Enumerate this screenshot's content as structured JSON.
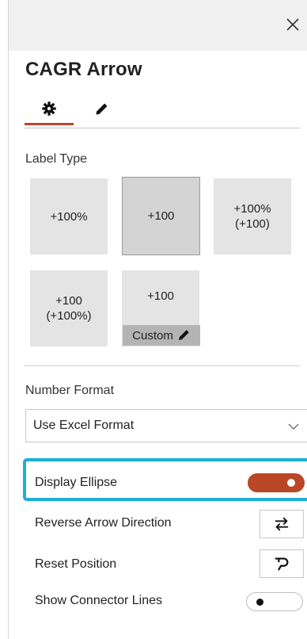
{
  "panel": {
    "title": "CAGR Arrow",
    "close_icon": "close-icon",
    "tabs": [
      {
        "name": "settings",
        "icon": "gear-icon",
        "active": true
      },
      {
        "name": "style",
        "icon": "pencil-icon",
        "active": false
      }
    ]
  },
  "label_type": {
    "heading": "Label Type",
    "options": [
      {
        "text": "+100%",
        "selected": false
      },
      {
        "text": "+100",
        "selected": true
      },
      {
        "text": "+100%\n(+100)",
        "selected": false
      },
      {
        "text": "+100\n(+100%)",
        "selected": false
      },
      {
        "text": "+100",
        "selected": false,
        "custom_label": "Custom"
      }
    ]
  },
  "number_format": {
    "heading": "Number Format",
    "value": "Use Excel Format"
  },
  "options": {
    "display_ellipse": {
      "label": "Display Ellipse",
      "on": true
    },
    "reverse_arrow": {
      "label": "Reverse Arrow Direction",
      "icon": "swap-arrows-icon"
    },
    "reset_position": {
      "label": "Reset Position",
      "icon": "undo-icon"
    },
    "connector_lines": {
      "label": "Show Connector Lines",
      "on": false
    }
  },
  "colors": {
    "accent": "#c0432a",
    "toggle_on": "#b94626",
    "highlight": "#1aaed9",
    "tile_bg": "#e4e4e4",
    "tile_selected_bg": "#d4d4d4"
  }
}
